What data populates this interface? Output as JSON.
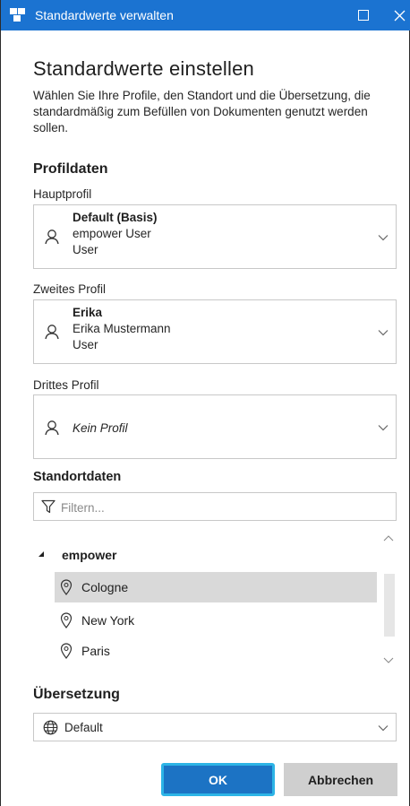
{
  "window": {
    "title": "Standardwerte verwalten",
    "accent_color": "#1b73d1"
  },
  "header": {
    "heading": "Standardwerte einstellen",
    "intro": "Wählen Sie Ihre Profile, den Standort und die Übersetzung, die standardmäßig zum Befüllen von Dokumenten genutzt werden sollen."
  },
  "profiles": {
    "section_title": "Profildaten",
    "primary": {
      "label": "Hauptprofil",
      "name": "Default (Basis)",
      "line2": "empower User",
      "line3": "User"
    },
    "secondary": {
      "label": "Zweites Profil",
      "name": "Erika",
      "line2": "Erika Mustermann",
      "line3": "User"
    },
    "tertiary": {
      "label": "Drittes Profil",
      "value": "Kein Profil"
    }
  },
  "location": {
    "section_title": "Standortdaten",
    "filter_placeholder": "Filtern...",
    "group": "empower",
    "items": [
      {
        "label": "Cologne",
        "selected": true
      },
      {
        "label": "New York",
        "selected": false
      },
      {
        "label": "Paris",
        "selected": false
      }
    ]
  },
  "translation": {
    "section_title": "Übersetzung",
    "value": "Default"
  },
  "buttons": {
    "ok": "OK",
    "cancel": "Abbrechen"
  },
  "icons": {
    "app": "app-logo-icon",
    "maximize": "maximize-icon",
    "close": "close-icon",
    "person": "person-icon",
    "chevron": "chevron-down-icon",
    "filter": "filter-icon",
    "caret": "expand-caret-icon",
    "pin": "location-pin-icon",
    "globe": "globe-icon"
  }
}
